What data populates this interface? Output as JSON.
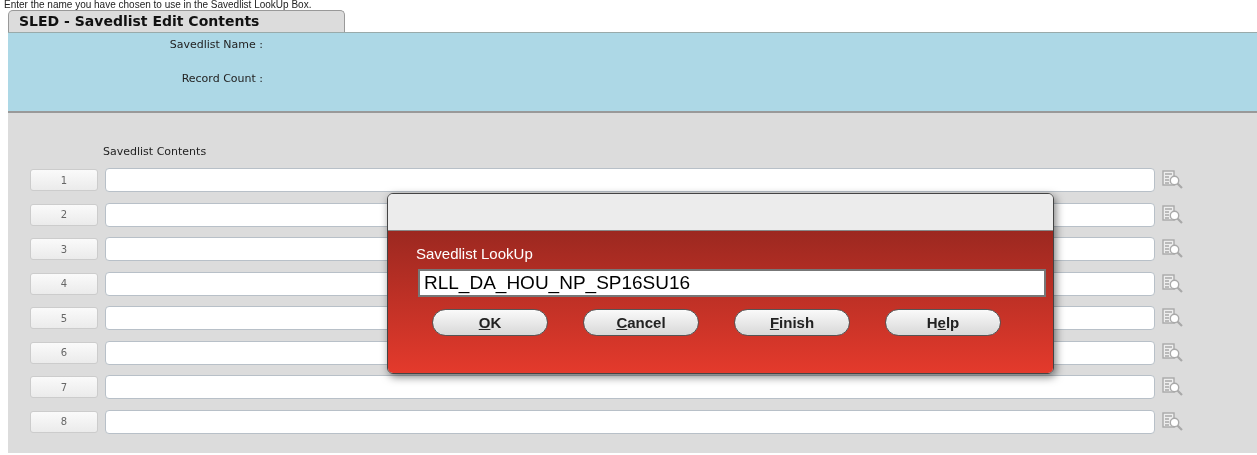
{
  "caption": "Enter the name you have chosen to use in the Savedlist LookUp Box.",
  "tab": {
    "label": "SLED - Savedlist Edit Contents",
    "selected": true
  },
  "header_fields": [
    {
      "label": "Savedlist Name :"
    },
    {
      "label": "Record Count :"
    }
  ],
  "contents": {
    "label": "Savedlist Contents",
    "rows": [
      {
        "number": "1"
      },
      {
        "number": "2"
      },
      {
        "number": "3"
      },
      {
        "number": "4"
      },
      {
        "number": "5"
      },
      {
        "number": "6"
      },
      {
        "number": "7"
      },
      {
        "number": "8"
      }
    ]
  },
  "dialog": {
    "label": "Savedlist LookUp",
    "value": "RLL_DA_HOU_NP_SP16SU16",
    "buttons": [
      {
        "parts": [
          {
            "text": "O",
            "underlined": true
          },
          {
            "text": "K",
            "underlined": false
          }
        ]
      },
      {
        "parts": [
          {
            "text": "C",
            "underlined": true
          },
          {
            "text": "ancel",
            "underlined": false
          }
        ]
      },
      {
        "parts": [
          {
            "text": "F",
            "underlined": true
          },
          {
            "text": "inish",
            "underlined": false
          }
        ]
      },
      {
        "parts": [
          {
            "text": "H",
            "underlined": false
          },
          {
            "text": "e",
            "underlined": true
          },
          {
            "text": "lp",
            "underlined": false
          }
        ]
      }
    ]
  }
}
